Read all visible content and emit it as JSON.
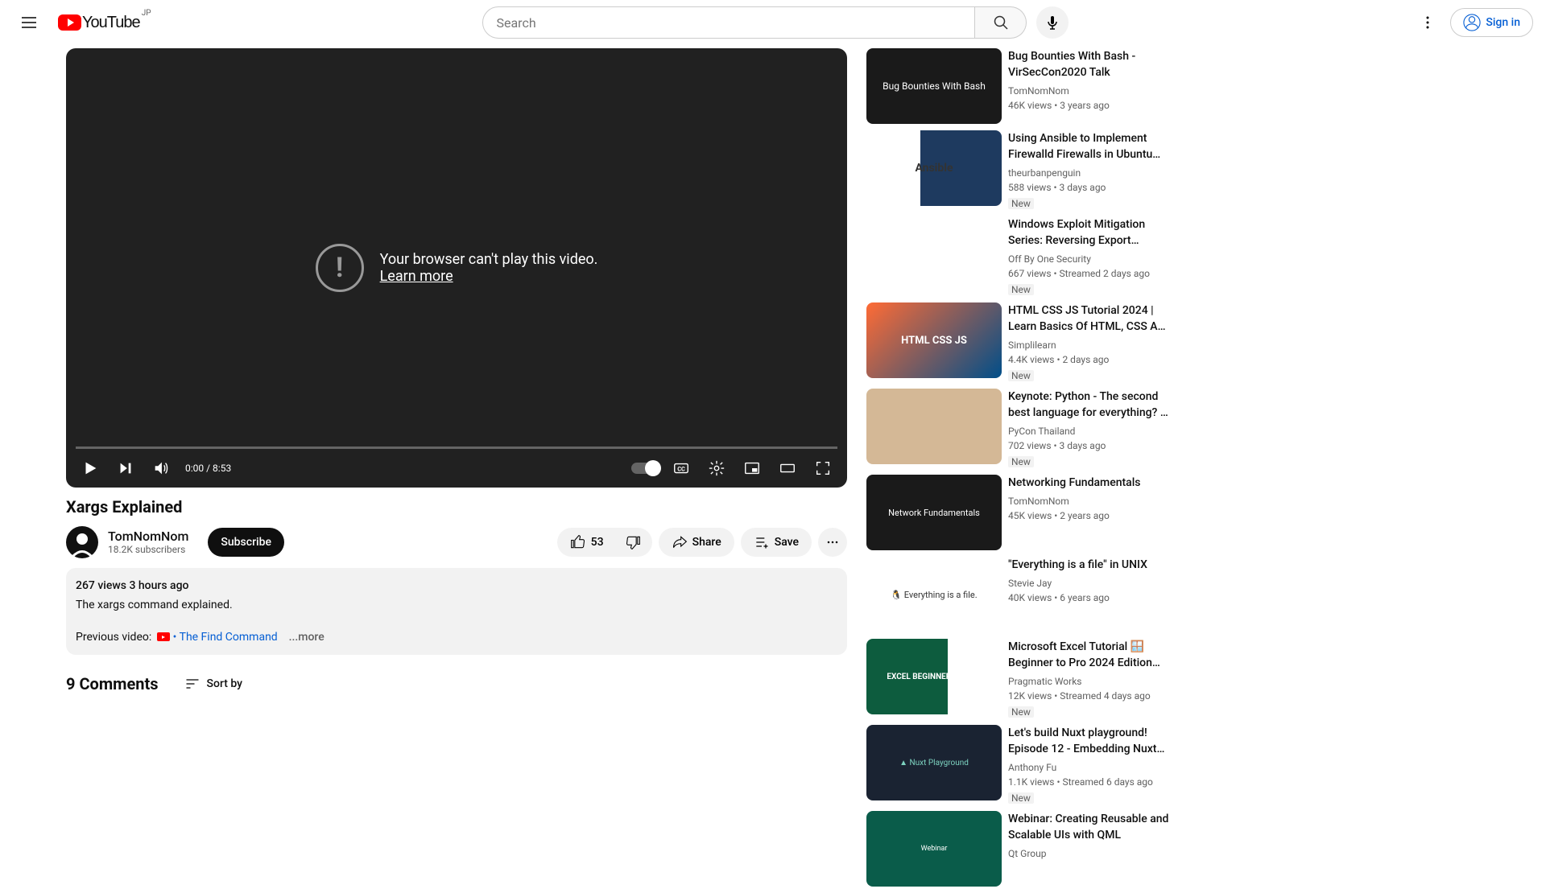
{
  "header": {
    "logo_text": "YouTube",
    "country_code": "JP",
    "search_placeholder": "Search",
    "signin_label": "Sign in"
  },
  "player": {
    "error_text": "Your browser can't play this video.",
    "learn_more": "Learn more",
    "time": "0:00 / 8:53"
  },
  "video": {
    "title": "Xargs Explained",
    "channel_name": "TomNomNom",
    "sub_count": "18.2K subscribers",
    "subscribe_label": "Subscribe",
    "like_count": "53",
    "share_label": "Share",
    "save_label": "Save"
  },
  "description": {
    "meta": "267 views  3 hours ago",
    "text": "The xargs command explained.",
    "prev_label": "Previous video:",
    "prev_link": " • The Find Command",
    "more": "...more"
  },
  "comments": {
    "count_label": "9 Comments",
    "sort_label": "Sort by"
  },
  "new_badge": "New",
  "recs": [
    {
      "title": "Bug Bounties With Bash - VirSecCon2020 Talk",
      "channel": "TomNomNom",
      "meta": "46K views  • 3 years ago",
      "new": false,
      "thumb": "thumb-t1",
      "thumb_text": "Bug Bounties With Bash"
    },
    {
      "title": "Using Ansible to Implement Firewalld Firewalls in Ubuntu…",
      "channel": "theurbanpenguin",
      "meta": "588 views  • 3 days ago",
      "new": true,
      "thumb": "thumb-t2",
      "thumb_text": "Ansible"
    },
    {
      "title": "Windows Exploit Mitigation Series: Reversing Export…",
      "channel": "Off By One Security",
      "meta": "667 views  • Streamed 2 days ago",
      "new": true,
      "thumb": "thumb-t3",
      "thumb_text": ""
    },
    {
      "title": "HTML CSS JS Tutorial 2024 | Learn Basics Of HTML, CSS A…",
      "channel": "Simplilearn",
      "meta": "4.4K views  • 2 days ago",
      "new": true,
      "thumb": "thumb-t4",
      "thumb_text": "HTML CSS JS"
    },
    {
      "title": "Keynote: Python - The second best language for everything? …",
      "channel": "PyCon Thailand",
      "meta": "702 views  • 3 days ago",
      "new": true,
      "thumb": "thumb-t5",
      "thumb_text": ""
    },
    {
      "title": "Networking Fundamentals",
      "channel": "TomNomNom",
      "meta": "45K views  • 2 years ago",
      "new": false,
      "thumb": "thumb-t6",
      "thumb_text": "Network Fundamentals"
    },
    {
      "title": "\"Everything is a file\" in UNIX",
      "channel": "Stevie Jay",
      "meta": "40K views  • 6 years ago",
      "new": false,
      "thumb": "thumb-t7",
      "thumb_text": "🐧 Everything is a file."
    },
    {
      "title": "Microsoft Excel Tutorial 🪟 Beginner to Pro 2024 Edition…",
      "channel": "Pragmatic Works",
      "meta": "12K views  • Streamed 4 days ago",
      "new": true,
      "thumb": "thumb-t8",
      "thumb_text": "EXCEL BEGINNER TO PRO"
    },
    {
      "title": "Let's build Nuxt playground! Episode 12 - Embedding Nuxt…",
      "channel": "Anthony Fu",
      "meta": "1.1K views  • Streamed 6 days ago",
      "new": true,
      "thumb": "thumb-t9",
      "thumb_text": "▲ Nuxt Playground"
    },
    {
      "title": "Webinar: Creating Reusable and Scalable UIs with QML",
      "channel": "Qt Group",
      "meta": "",
      "new": false,
      "thumb": "thumb-t10",
      "thumb_text": "Webinar"
    }
  ]
}
